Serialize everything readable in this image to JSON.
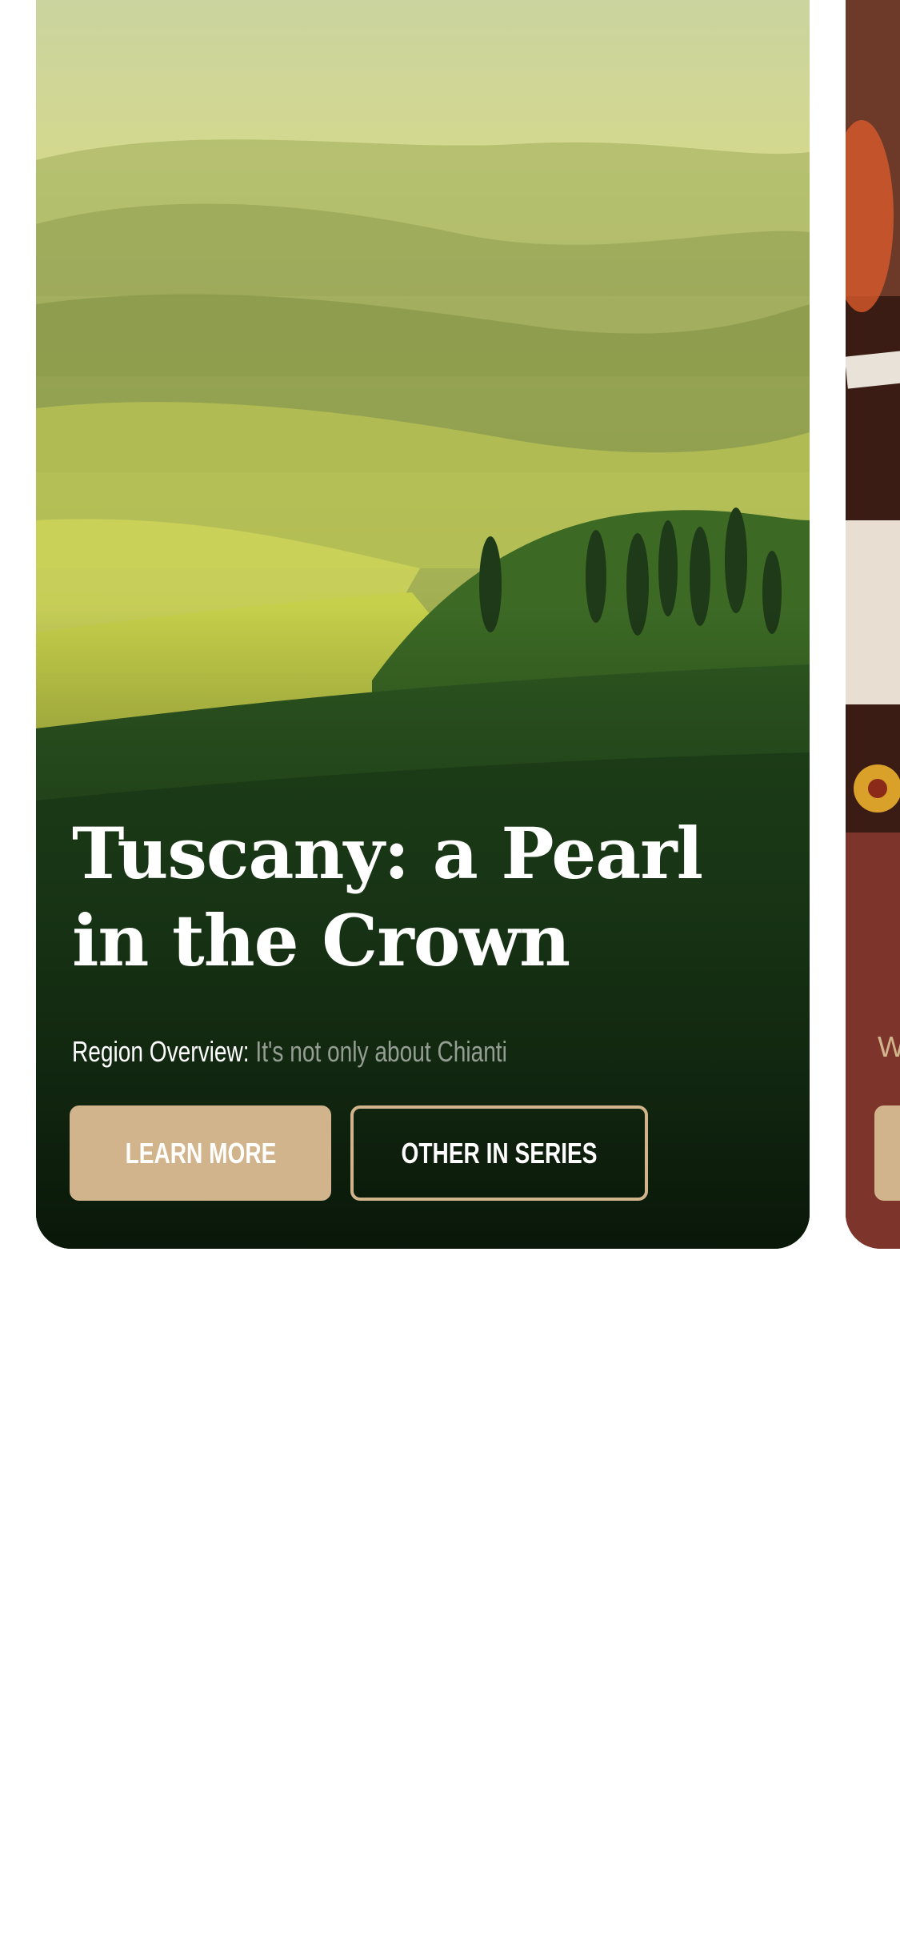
{
  "card": {
    "title": "Tuscany: a Pearl in the Crown",
    "subtitle_label": "Region Overview:",
    "subtitle_text": " It's not only about Chianti",
    "primary_button": "LEARN MORE",
    "secondary_button": "OTHER IN SERIES"
  },
  "peek_card": {
    "subtitle_initial": "W"
  },
  "colors": {
    "accent": "#d2b48c",
    "text": "#ffffff",
    "background": "#ffffff"
  }
}
